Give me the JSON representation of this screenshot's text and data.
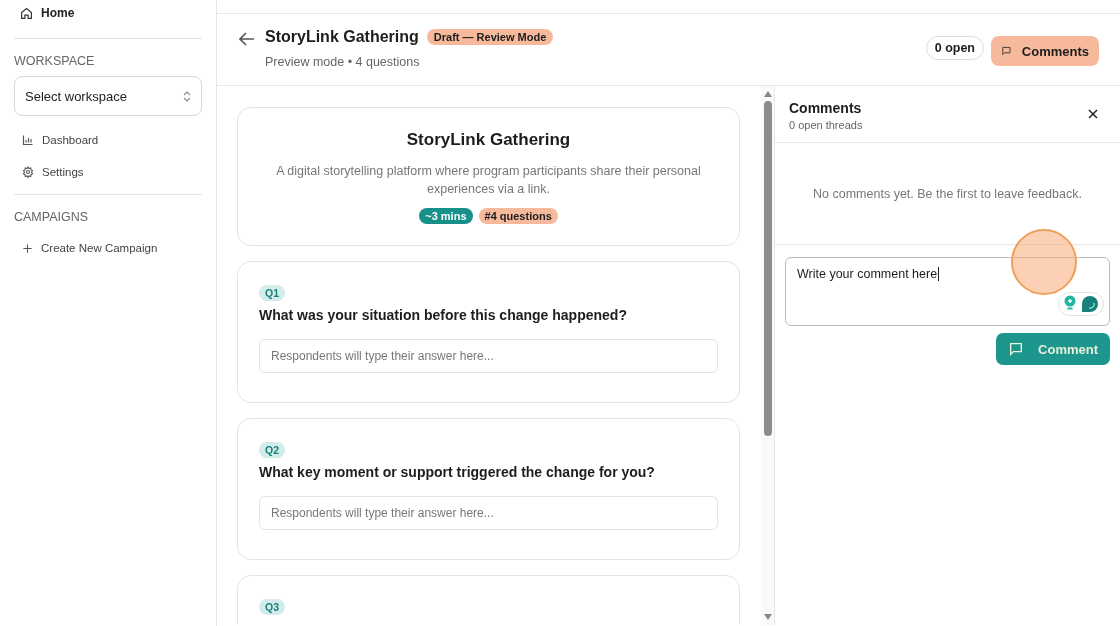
{
  "sidebar": {
    "home": "Home",
    "sections": [
      {
        "heading": "WORKSPACE",
        "select": {
          "value": "Select workspace"
        },
        "items": [
          {
            "label": "Dashboard"
          },
          {
            "label": "Settings"
          }
        ]
      },
      {
        "heading": "CAMPAIGNS",
        "items": [
          {
            "label": "Create New Campaign"
          }
        ]
      }
    ]
  },
  "header": {
    "title": "StoryLink Gathering",
    "badge": "Draft — Review Mode",
    "subtitle": "Preview mode • 4 questions",
    "open_count": "0 open",
    "comments_button": "Comments"
  },
  "intro": {
    "title": "StoryLink Gathering",
    "description": "A digital storytelling platform where program participants share their personal experiences via a link.",
    "tags": [
      {
        "label": "~3 mins",
        "color": "#17908a"
      },
      {
        "label": "#4 questions",
        "color": "#f7b99c"
      }
    ]
  },
  "questions": [
    {
      "number": "Q1",
      "text": "What was your situation before this change happened?",
      "placeholder": "Respondents will type their answer here..."
    },
    {
      "number": "Q2",
      "text": "What key moment or support triggered the change for you?",
      "placeholder": "Respondents will type their answer here..."
    },
    {
      "number": "Q3"
    }
  ],
  "comments": {
    "title": "Comments",
    "subtitle": "0 open threads",
    "empty": "No comments yet. Be the first to leave feedback.",
    "input": {
      "value": "Write your comment here"
    },
    "submit": "Comment"
  }
}
